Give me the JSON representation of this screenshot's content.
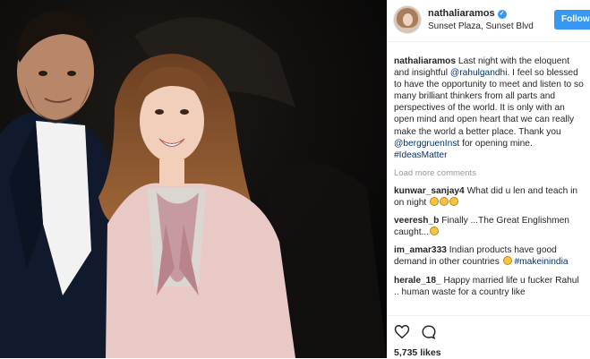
{
  "post": {
    "username": "nathaliaramos",
    "verified_mark": "✓",
    "location": "Sunset Plaza, Sunset Blvd",
    "follow_label": "Follow"
  },
  "caption": {
    "username": "nathaliaramos",
    "text_1": "Last night with the eloquent and insightful",
    "mention_1": "@rahulgandhi",
    "text_2": ". I feel so blessed to have the opportunity to meet and listen to so many brilliant thinkers from all parts and perspectives of the world. It is only with an open mind and open heart that we can really make the world a better place. Thank you",
    "mention_2": "@berggruenInst",
    "text_3": "for opening mine.",
    "hashtag": "#IdeasMatter"
  },
  "load_more_label": "Load more comments",
  "comments": [
    {
      "username": "kunwar_sanjay4",
      "text": "What did u len and teach in on night",
      "emoji_count": 3
    },
    {
      "username": "veeresh_b",
      "text": "Finally ...The Great Englishmen caught...",
      "emoji_count": 1
    },
    {
      "username": "im_amar333",
      "text": "Indian products have good demand in other countries",
      "emoji_count": 1,
      "hashtag": "#makeinindia"
    },
    {
      "username": "herale_18_",
      "text": "Happy married life u fucker Rahul .. human waste for a country like",
      "emoji_count": 0
    }
  ],
  "icons": {
    "like": "heart-icon",
    "comment": "comment-icon",
    "verified": "verified-badge-icon",
    "avatar": "avatar"
  },
  "likes": "5,735 likes",
  "colors": {
    "accent": "#3897f0",
    "link": "#003569",
    "muted": "#999999",
    "text": "#262626"
  }
}
